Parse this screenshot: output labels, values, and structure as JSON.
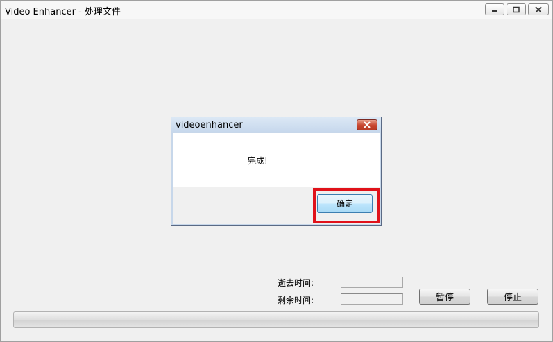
{
  "window": {
    "title": "Video Enhancer - 处理文件"
  },
  "dialog": {
    "title": "videoenhancer",
    "message": "完成!",
    "ok_label": "确定"
  },
  "stats": {
    "elapsed_label": "逝去时间:",
    "elapsed_value": "",
    "remaining_label": "剩余时间:",
    "remaining_value": ""
  },
  "controls": {
    "pause_label": "暂停",
    "stop_label": "停止"
  },
  "progress": {
    "value_percent": 0
  },
  "colors": {
    "highlight": "#e0121a",
    "dialog_close": "#c7452f"
  }
}
